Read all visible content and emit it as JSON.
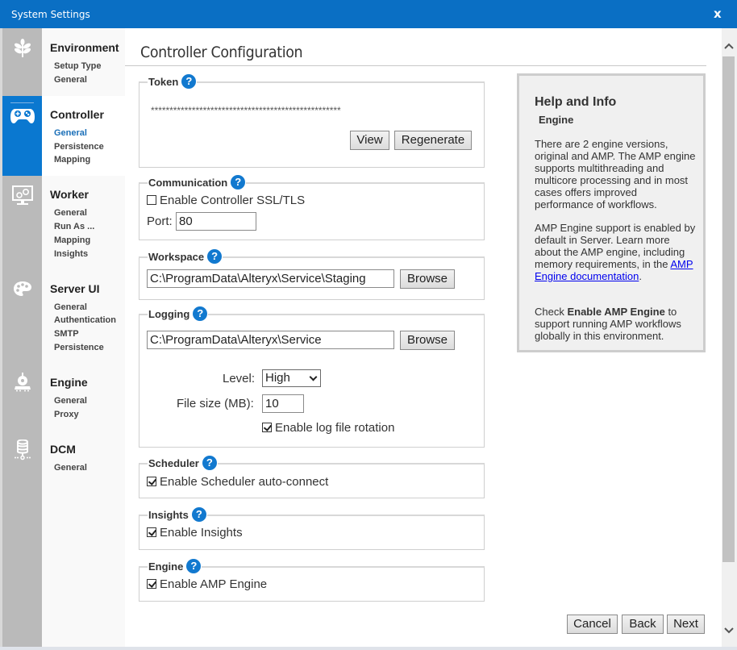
{
  "window": {
    "title": "System Settings",
    "close_label": "x"
  },
  "sidebar": {
    "groups": [
      {
        "title": "Environment",
        "icon": "leaf-icon",
        "active": false,
        "items": [
          "Setup Type",
          "General"
        ]
      },
      {
        "title": "Controller",
        "icon": "gamepad-icon",
        "active": true,
        "current_item": "General",
        "items": [
          "General",
          "Persistence",
          "Mapping"
        ]
      },
      {
        "title": "Worker",
        "icon": "monitor-gears-icon",
        "active": false,
        "items": [
          "General",
          "Run As ...",
          "Mapping",
          "Insights"
        ]
      },
      {
        "title": "Server UI",
        "icon": "palette-icon",
        "active": false,
        "items": [
          "General",
          "Authentication",
          "SMTP",
          "Persistence"
        ]
      },
      {
        "title": "Engine",
        "icon": "train-engine-icon",
        "active": false,
        "items": [
          "General",
          "Proxy"
        ]
      },
      {
        "title": "DCM",
        "icon": "database-network-icon",
        "active": false,
        "items": [
          "General"
        ]
      }
    ]
  },
  "main": {
    "title": "Controller Configuration",
    "token": {
      "legend": "Token",
      "value": "***************************************************",
      "view_label": "View",
      "regenerate_label": "Regenerate"
    },
    "communication": {
      "legend": "Communication",
      "ssl_label": "Enable Controller SSL/TLS",
      "ssl_checked": false,
      "port_label": "Port:",
      "port_value": "80"
    },
    "workspace": {
      "legend": "Workspace",
      "path": "C:\\ProgramData\\Alteryx\\Service\\Staging",
      "browse_label": "Browse"
    },
    "logging": {
      "legend": "Logging",
      "path": "C:\\ProgramData\\Alteryx\\Service",
      "browse_label": "Browse",
      "level_label": "Level:",
      "level_value": "High",
      "filesize_label": "File size (MB):",
      "filesize_value": "10",
      "rotation_label": "Enable log file rotation",
      "rotation_checked": true
    },
    "scheduler": {
      "legend": "Scheduler",
      "autoconnect_label": "Enable Scheduler auto-connect",
      "autoconnect_checked": true
    },
    "insights": {
      "legend": "Insights",
      "enable_label": "Enable Insights",
      "enable_checked": true
    },
    "engine": {
      "legend": "Engine",
      "amp_label": "Enable AMP Engine",
      "amp_checked": true
    },
    "help_icon": "?"
  },
  "help_panel": {
    "heading": "Help and Info",
    "subheading": "Engine",
    "para1": "There are 2 engine versions, original and AMP. The AMP engine supports multithreading and multicore processing and in most cases offers improved performance of workflows.",
    "para2_before": "AMP Engine support is enabled by default in Server. Learn more about the AMP engine, including memory requirements, in the ",
    "para2_link": "AMP Engine documentation",
    "para2_after": ".",
    "para3_before": "Check ",
    "para3_bold": "Enable AMP Engine",
    "para3_after": " to support running AMP workflows globally in this environment."
  },
  "footer": {
    "cancel_label": "Cancel",
    "back_label": "Back",
    "next_label": "Next"
  },
  "colors": {
    "accent": "#0a6fc4",
    "active_rail": "#0a78d0",
    "help_icon": "#1279cf",
    "link": "#0000ee"
  }
}
